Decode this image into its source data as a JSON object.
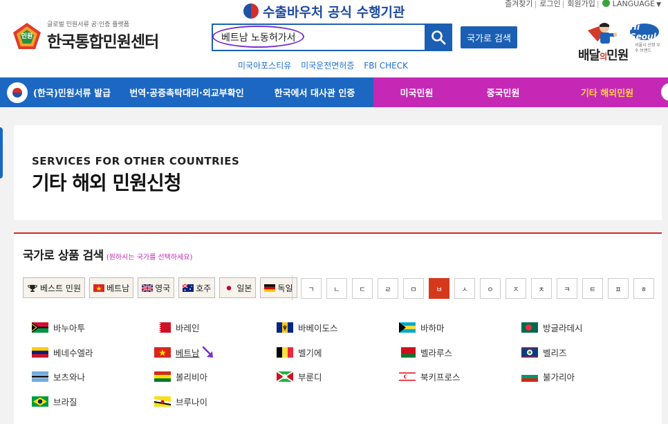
{
  "top_links": {
    "find": "즐겨찾기",
    "login": "로그인",
    "join": "회원가입",
    "language": "LANGUAGE"
  },
  "voucher": {
    "text": "수출바우처 공식 수행기관"
  },
  "logo": {
    "badge": "민원",
    "sub": "글로벌 민원서류 공·인증 플랫폼",
    "main": "한국통합민원센터"
  },
  "search": {
    "value": "베트남 노동허가서",
    "button_label": "국가로 검색"
  },
  "quick_links": [
    "미국아포스티유",
    "미국운전면허증",
    "FBI CHECK"
  ],
  "delivery": {
    "hi": "Hi Seoul",
    "word_left": "배달",
    "word_mid": "의",
    "word_right": "민원",
    "small": "서울시 선정 우수 브랜드"
  },
  "nav": [
    {
      "label": "(한국)민원서류 발급"
    },
    {
      "label": "번역·공증촉탁대리·외교부확인"
    },
    {
      "label": "한국에서 대사관 인증"
    },
    {
      "label": "미국민원"
    },
    {
      "label": "중국민원"
    },
    {
      "label": "기타 해외민원"
    }
  ],
  "hero": {
    "en": "SERVICES FOR OTHER COUNTRIES",
    "ko": "기타 해외 민원신청"
  },
  "product_search": {
    "title": "국가로 상품 검색",
    "note": "(원하시는 국가를 선택하세요)"
  },
  "quick_buttons": [
    {
      "label": "베스트 민원",
      "icon": "trophy-icon"
    },
    {
      "label": "베트남",
      "icon": "vietnam-flag"
    },
    {
      "label": "영국",
      "icon": "uk-flag"
    },
    {
      "label": "호주",
      "icon": "australia-flag"
    },
    {
      "label": "일본",
      "icon": "japan-flag"
    },
    {
      "label": "독일",
      "icon": "germany-flag"
    }
  ],
  "jamo": [
    "ㄱ",
    "ㄴ",
    "ㄷ",
    "ㄹ",
    "ㅁ",
    "ㅂ",
    "ㅅ",
    "ㅇ",
    "ㅈ",
    "ㅊ",
    "ㅋ",
    "ㅌ",
    "ㅍ",
    "ㅎ"
  ],
  "jamo_selected": "ㅂ",
  "countries": [
    [
      "바누아투",
      "바레인",
      "바베이도스",
      "바하마",
      "방글라데시"
    ],
    [
      "베네수엘라",
      "베트남",
      "벨기에",
      "벨라루스",
      "벨리즈"
    ],
    [
      "보츠와나",
      "볼리비아",
      "부룬디",
      "북키프로스",
      "불가리아"
    ],
    [
      "브라질",
      "브루나이"
    ]
  ],
  "colors": {
    "brand_blue": "#1c67c2",
    "magenta": "#c628b6",
    "accent_red": "#c62f27",
    "search_oval": "#7b2fc9"
  }
}
